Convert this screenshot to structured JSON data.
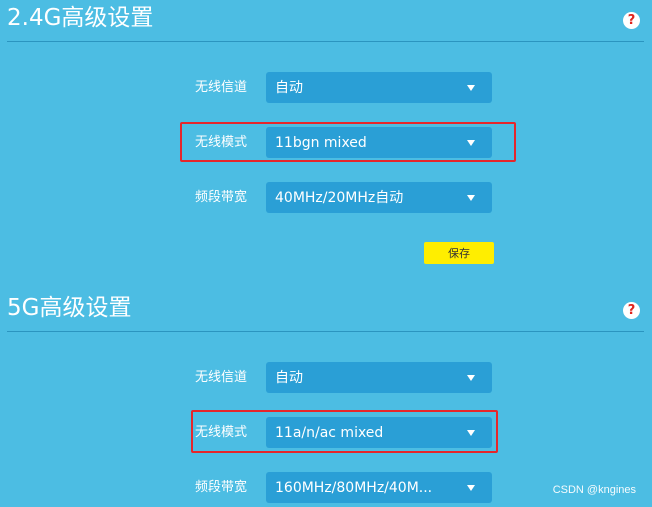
{
  "section_24g": {
    "title": "2.4G高级设置",
    "help": "?",
    "channel": {
      "label": "无线信道",
      "value": "自动"
    },
    "mode": {
      "label": "无线模式",
      "value": "11bgn mixed"
    },
    "bandwidth": {
      "label": "频段带宽",
      "value": "40MHz/20MHz自动"
    },
    "save_label": "保存"
  },
  "section_5g": {
    "title": "5G高级设置",
    "help": "?",
    "channel": {
      "label": "无线信道",
      "value": "自动"
    },
    "mode": {
      "label": "无线模式",
      "value": "11a/n/ac mixed"
    },
    "bandwidth": {
      "label": "频段带宽",
      "value": "160MHz/80MHz/40M..."
    }
  },
  "watermark": "CSDN @kngines",
  "colors": {
    "background": "#4cbde3",
    "select": "#2a9fd6",
    "highlight": "#e6262b",
    "save_button": "#ffee00"
  }
}
